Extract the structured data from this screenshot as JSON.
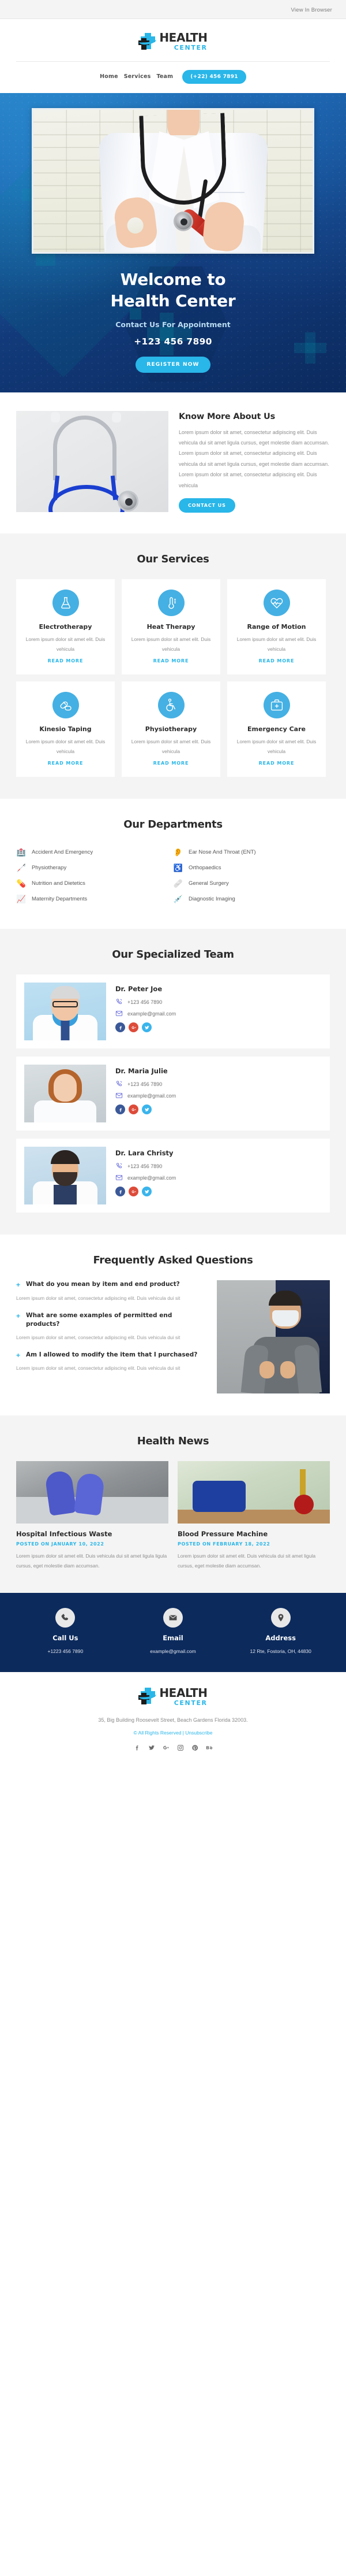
{
  "preheader": {
    "view_in_browser": "View In Browser"
  },
  "logo": {
    "line1": "HEALTH",
    "line2": "CENTER"
  },
  "nav": {
    "items": [
      {
        "label": "Home"
      },
      {
        "label": "Services"
      },
      {
        "label": "Team"
      }
    ],
    "phone_pill": "(+22) 456 7891"
  },
  "hero": {
    "title_line1": "Welcome to",
    "title_line2": "Health Center",
    "subtitle": "Contact Us For Appointment",
    "phone": "+123 456 7890",
    "cta": "REGISTER NOW"
  },
  "about": {
    "title": "Know More About Us",
    "body": "Lorem ipsum dolor sit amet, consectetur adipiscing elit. Duis vehicula dui sit amet ligula cursus, eget molestie diam accumsan. Lorem ipsum dolor sit amet, consectetur adipiscing elit. Duis vehicula dui sit amet ligula cursus, eget molestie diam accumsan. Lorem ipsum dolor sit amet, consectetur adipiscing elit. Duis vehicula",
    "cta": "CONTACT US"
  },
  "services": {
    "title": "Our Services",
    "read_more": "READ MORE",
    "items": [
      {
        "icon": "flask-icon",
        "name": "Electrotherapy",
        "desc": "Lorem ipsum dolor sit amet elit. Duis vehicula"
      },
      {
        "icon": "thermometer-icon",
        "name": "Heat Therapy",
        "desc": "Lorem ipsum dolor sit amet elit. Duis vehicula"
      },
      {
        "icon": "heart-pulse-icon",
        "name": "Range of Motion",
        "desc": "Lorem ipsum dolor sit amet elit. Duis vehicula"
      },
      {
        "icon": "pills-icon",
        "name": "Kinesio Taping",
        "desc": "Lorem ipsum dolor sit amet elit. Duis vehicula"
      },
      {
        "icon": "wheelchair-icon",
        "name": "Physiotherapy",
        "desc": "Lorem ipsum dolor sit amet elit. Duis vehicula"
      },
      {
        "icon": "first-aid-kit-icon",
        "name": "Emergency Care",
        "desc": "Lorem ipsum dolor sit amet elit. Duis vehicula"
      }
    ]
  },
  "departments": {
    "title": "Our Departments",
    "items": [
      {
        "emoji": "🏥",
        "label": "Accident And Emergency"
      },
      {
        "emoji": "👂",
        "label": "Ear Nose And Throat (ENT)"
      },
      {
        "emoji": "🦯",
        "label": "Physiotherapy"
      },
      {
        "emoji": "♿",
        "label": "Orthopaedics"
      },
      {
        "emoji": "💊",
        "label": "Nutrition and Dietetics"
      },
      {
        "emoji": "🩹",
        "label": "General Surgery"
      },
      {
        "emoji": "📈",
        "label": "Maternity Departments"
      },
      {
        "emoji": "💉",
        "label": "Diagnostic Imaging"
      }
    ]
  },
  "team": {
    "title": "Our Specialized Team",
    "members": [
      {
        "name": "Dr. Peter Joe",
        "phone": "+123 456 7890",
        "email": "example@gmail.com"
      },
      {
        "name": "Dr. Maria Julie",
        "phone": "+123 456 7890",
        "email": "example@gmail.com"
      },
      {
        "name": "Dr. Lara Christy",
        "phone": "+123 456 7890",
        "email": "example@gmail.com"
      }
    ],
    "social": {
      "facebook": "facebook-icon",
      "google_plus": "google-plus-icon",
      "twitter": "twitter-icon"
    }
  },
  "faq": {
    "title": "Frequently Asked Questions",
    "items": [
      {
        "question": "What do you mean by item and end product?",
        "answer": "Lorem ipsum dolor sit amet, consectetur adipiscing elit. Duis vehicula dui sit"
      },
      {
        "question": "What are some examples of permitted end products?",
        "answer": "Lorem ipsum dolor sit amet, consectetur adipiscing elit. Duis vehicula dui sit"
      },
      {
        "question": "Am I allowed to modify the item that I purchased?",
        "answer": "Lorem ipsum dolor sit amet, consectetur adipiscing elit. Duis vehicula dui sit"
      }
    ]
  },
  "news": {
    "title": "Health News",
    "items": [
      {
        "title": "Hospital Infectious Waste",
        "date": "POSTED ON JANUARY 10, 2022",
        "excerpt": "Lorem ipsum dolor sit amet elit. Duis vehicula dui sit amet ligula ligula cursus, eget molestie diam accumsan."
      },
      {
        "title": "Blood Pressure Machine",
        "date": "POSTED ON FEBRUARY 18, 2022",
        "excerpt": "Lorem ipsum dolor sit amet elit. Duis vehicula dui sit amet ligula cursus, eget molestie diam accumsan."
      }
    ]
  },
  "contact_bar": {
    "call": {
      "label": "Call Us",
      "value": "+1223 456 7890",
      "icon": "phone-icon"
    },
    "email": {
      "label": "Email",
      "value": "example@gmail.com",
      "icon": "envelope-icon"
    },
    "address": {
      "label": "Address",
      "value": "12 Rte, Fostoria, OH, 44830",
      "icon": "location-pin-icon"
    }
  },
  "footer": {
    "address": "35, Big Building Roosevelt Street, Beach Gardens Florida 32003.",
    "rights": "© All Rights Reserved | ",
    "unsubscribe": "Unsubscribe",
    "socials": [
      "facebook-icon",
      "twitter-icon",
      "google-plus-icon",
      "instagram-icon",
      "pinterest-icon",
      "behance-icon"
    ]
  },
  "colors": {
    "accent": "#29b6e8",
    "hero_dark": "#0c2a5c",
    "text_dark": "#2b2b2b",
    "text_muted": "#8d8d8d"
  }
}
